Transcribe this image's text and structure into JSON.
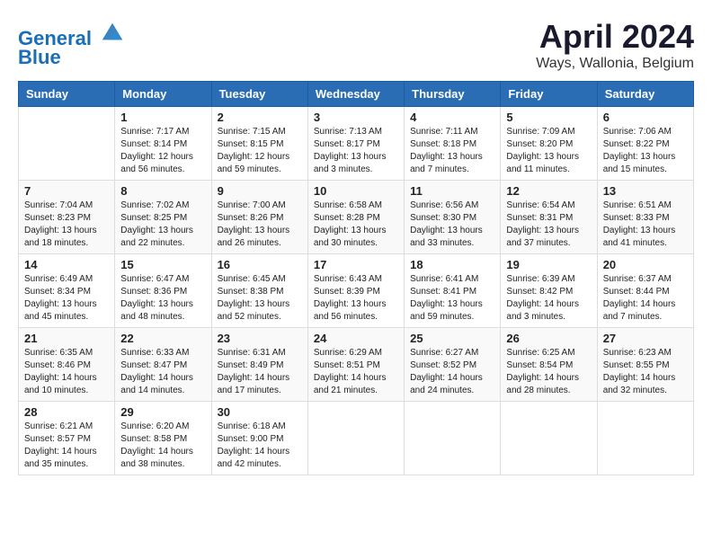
{
  "header": {
    "logo_line1": "General",
    "logo_line2": "Blue",
    "month_title": "April 2024",
    "location": "Ways, Wallonia, Belgium"
  },
  "weekdays": [
    "Sunday",
    "Monday",
    "Tuesday",
    "Wednesday",
    "Thursday",
    "Friday",
    "Saturday"
  ],
  "weeks": [
    [
      {
        "day": "",
        "empty": true
      },
      {
        "day": "1",
        "sunrise": "7:17 AM",
        "sunset": "8:14 PM",
        "daylight": "12 hours and 56 minutes."
      },
      {
        "day": "2",
        "sunrise": "7:15 AM",
        "sunset": "8:15 PM",
        "daylight": "12 hours and 59 minutes."
      },
      {
        "day": "3",
        "sunrise": "7:13 AM",
        "sunset": "8:17 PM",
        "daylight": "13 hours and 3 minutes."
      },
      {
        "day": "4",
        "sunrise": "7:11 AM",
        "sunset": "8:18 PM",
        "daylight": "13 hours and 7 minutes."
      },
      {
        "day": "5",
        "sunrise": "7:09 AM",
        "sunset": "8:20 PM",
        "daylight": "13 hours and 11 minutes."
      },
      {
        "day": "6",
        "sunrise": "7:06 AM",
        "sunset": "8:22 PM",
        "daylight": "13 hours and 15 minutes."
      }
    ],
    [
      {
        "day": "7",
        "sunrise": "7:04 AM",
        "sunset": "8:23 PM",
        "daylight": "13 hours and 18 minutes."
      },
      {
        "day": "8",
        "sunrise": "7:02 AM",
        "sunset": "8:25 PM",
        "daylight": "13 hours and 22 minutes."
      },
      {
        "day": "9",
        "sunrise": "7:00 AM",
        "sunset": "8:26 PM",
        "daylight": "13 hours and 26 minutes."
      },
      {
        "day": "10",
        "sunrise": "6:58 AM",
        "sunset": "8:28 PM",
        "daylight": "13 hours and 30 minutes."
      },
      {
        "day": "11",
        "sunrise": "6:56 AM",
        "sunset": "8:30 PM",
        "daylight": "13 hours and 33 minutes."
      },
      {
        "day": "12",
        "sunrise": "6:54 AM",
        "sunset": "8:31 PM",
        "daylight": "13 hours and 37 minutes."
      },
      {
        "day": "13",
        "sunrise": "6:51 AM",
        "sunset": "8:33 PM",
        "daylight": "13 hours and 41 minutes."
      }
    ],
    [
      {
        "day": "14",
        "sunrise": "6:49 AM",
        "sunset": "8:34 PM",
        "daylight": "13 hours and 45 minutes."
      },
      {
        "day": "15",
        "sunrise": "6:47 AM",
        "sunset": "8:36 PM",
        "daylight": "13 hours and 48 minutes."
      },
      {
        "day": "16",
        "sunrise": "6:45 AM",
        "sunset": "8:38 PM",
        "daylight": "13 hours and 52 minutes."
      },
      {
        "day": "17",
        "sunrise": "6:43 AM",
        "sunset": "8:39 PM",
        "daylight": "13 hours and 56 minutes."
      },
      {
        "day": "18",
        "sunrise": "6:41 AM",
        "sunset": "8:41 PM",
        "daylight": "13 hours and 59 minutes."
      },
      {
        "day": "19",
        "sunrise": "6:39 AM",
        "sunset": "8:42 PM",
        "daylight": "14 hours and 3 minutes."
      },
      {
        "day": "20",
        "sunrise": "6:37 AM",
        "sunset": "8:44 PM",
        "daylight": "14 hours and 7 minutes."
      }
    ],
    [
      {
        "day": "21",
        "sunrise": "6:35 AM",
        "sunset": "8:46 PM",
        "daylight": "14 hours and 10 minutes."
      },
      {
        "day": "22",
        "sunrise": "6:33 AM",
        "sunset": "8:47 PM",
        "daylight": "14 hours and 14 minutes."
      },
      {
        "day": "23",
        "sunrise": "6:31 AM",
        "sunset": "8:49 PM",
        "daylight": "14 hours and 17 minutes."
      },
      {
        "day": "24",
        "sunrise": "6:29 AM",
        "sunset": "8:51 PM",
        "daylight": "14 hours and 21 minutes."
      },
      {
        "day": "25",
        "sunrise": "6:27 AM",
        "sunset": "8:52 PM",
        "daylight": "14 hours and 24 minutes."
      },
      {
        "day": "26",
        "sunrise": "6:25 AM",
        "sunset": "8:54 PM",
        "daylight": "14 hours and 28 minutes."
      },
      {
        "day": "27",
        "sunrise": "6:23 AM",
        "sunset": "8:55 PM",
        "daylight": "14 hours and 32 minutes."
      }
    ],
    [
      {
        "day": "28",
        "sunrise": "6:21 AM",
        "sunset": "8:57 PM",
        "daylight": "14 hours and 35 minutes."
      },
      {
        "day": "29",
        "sunrise": "6:20 AM",
        "sunset": "8:58 PM",
        "daylight": "14 hours and 38 minutes."
      },
      {
        "day": "30",
        "sunrise": "6:18 AM",
        "sunset": "9:00 PM",
        "daylight": "14 hours and 42 minutes."
      },
      {
        "day": "",
        "empty": true
      },
      {
        "day": "",
        "empty": true
      },
      {
        "day": "",
        "empty": true
      },
      {
        "day": "",
        "empty": true
      }
    ]
  ]
}
